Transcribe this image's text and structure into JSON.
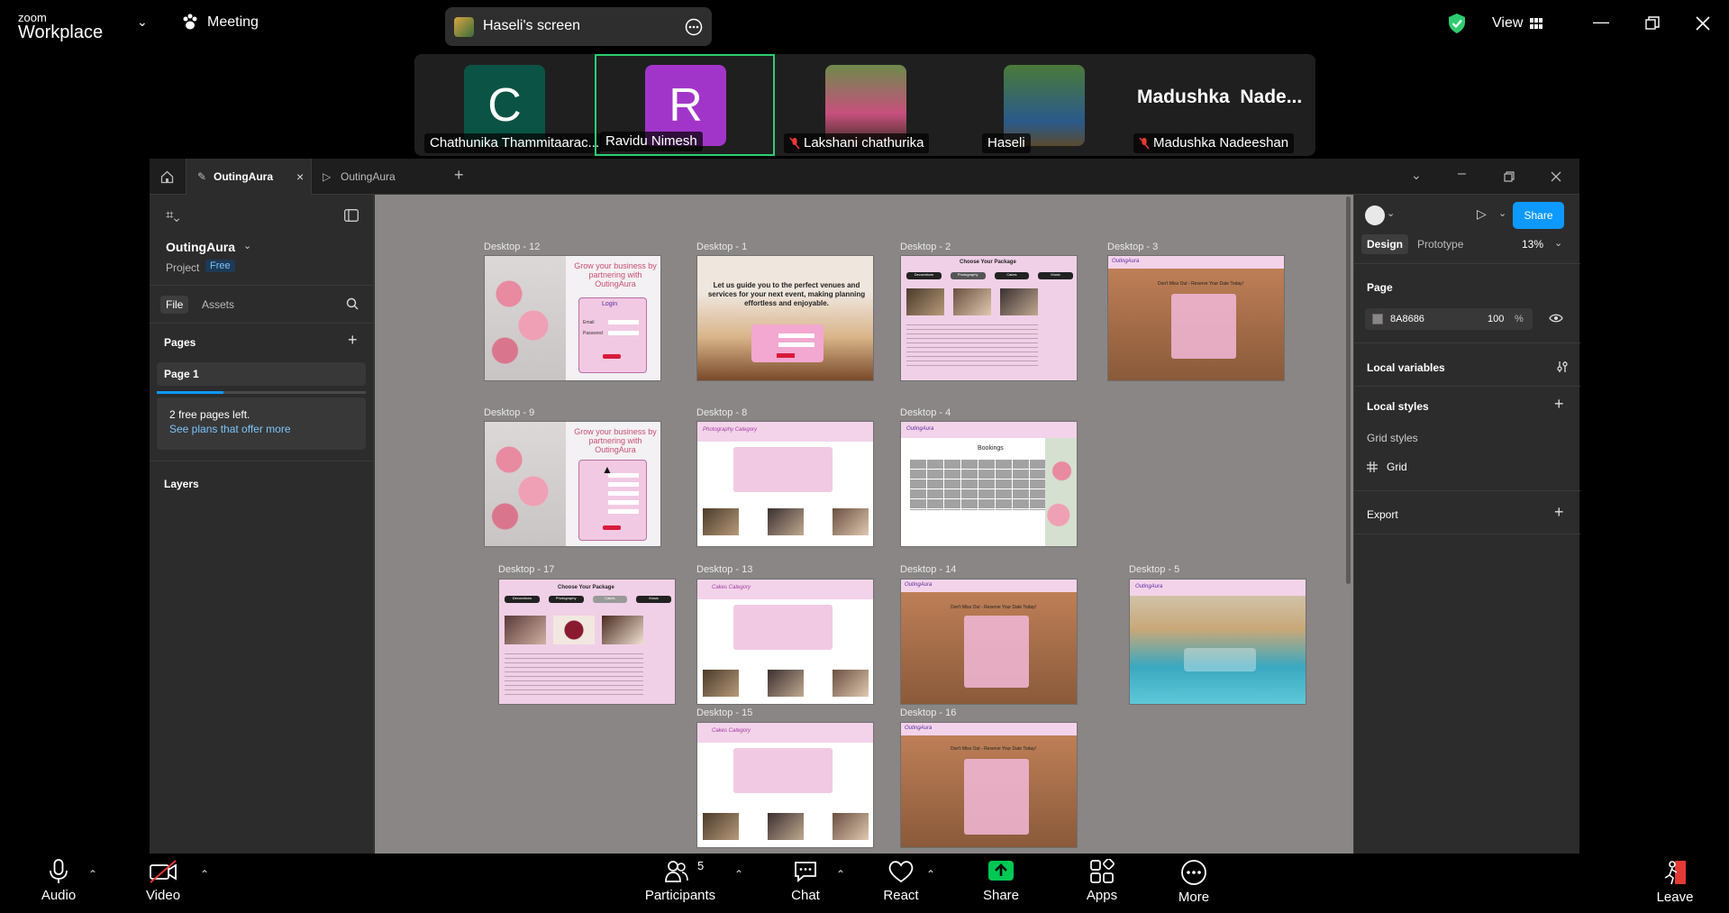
{
  "zoom": {
    "brand_small": "zoom",
    "brand_big": "Workplace",
    "meeting_label": "Meeting",
    "screen_label": "Haseli's screen",
    "view_label": "View",
    "colors": {
      "accent_green": "#2ecc71",
      "share_green": "#00c853",
      "leave_red": "#e53935"
    }
  },
  "participants": [
    {
      "initial": "C",
      "name": "Chathunika Thammitaarac...",
      "color": "#0b5345",
      "muted": false
    },
    {
      "initial": "R",
      "name": "Ravidu Nimesh",
      "color": "#a235c9",
      "muted": false,
      "active": true
    },
    {
      "initial": "",
      "name": "Lakshani chathurika",
      "color": "#4a6b3a",
      "muted": true
    },
    {
      "initial": "",
      "name": "Haseli",
      "color": "#3d6e3a",
      "muted": false
    },
    {
      "initial": "Madushka  Nade...",
      "name": "Madushka Nadeeshan",
      "color": "#1f1f1f",
      "muted": true
    }
  ],
  "figma": {
    "tabs": [
      {
        "label": "OutingAura",
        "active": true
      },
      {
        "label": "OutingAura",
        "active": false
      }
    ],
    "file_name": "OutingAura",
    "project_label": "Project",
    "plan_badge": "Free",
    "left_tabs": {
      "file": "File",
      "assets": "Assets"
    },
    "pages_heading": "Pages",
    "page_item": "Page 1",
    "free_pages_text": "2 free pages left.",
    "see_plans_link": "See plans that offer more",
    "layers_heading": "Layers",
    "right": {
      "share_label": "Share",
      "design_tab": "Design",
      "prototype_tab": "Prototype",
      "zoom_level": "13%",
      "page_heading": "Page",
      "page_color_hex": "8A8686",
      "page_opacity": "100",
      "percent_sign": "%",
      "local_variables": "Local variables",
      "local_styles": "Local styles",
      "grid_styles": "Grid styles",
      "grid_item": "Grid",
      "export_label": "Export"
    },
    "frames": [
      {
        "label": "Desktop - 12",
        "theme": "flowers-login"
      },
      {
        "label": "Desktop - 1",
        "theme": "event-hero"
      },
      {
        "label": "Desktop - 2",
        "theme": "package"
      },
      {
        "label": "Desktop - 3",
        "theme": "booking-form"
      },
      {
        "label": "Desktop - 9",
        "theme": "flowers-signup"
      },
      {
        "label": "Desktop - 8",
        "theme": "category"
      },
      {
        "label": "Desktop - 4",
        "theme": "bookings-table"
      },
      {
        "label": "Desktop - 17",
        "theme": "package"
      },
      {
        "label": "Desktop - 13",
        "theme": "category"
      },
      {
        "label": "Desktop - 14",
        "theme": "booking-form"
      },
      {
        "label": "Desktop - 5",
        "theme": "resort"
      },
      {
        "label": "Desktop - 15",
        "theme": "category"
      },
      {
        "label": "Desktop - 16",
        "theme": "booking-form"
      }
    ],
    "frame_text": {
      "grow_text": "Grow your business by partnering with OutingAura",
      "login_title": "Login",
      "email": "Email",
      "password": "Password",
      "hero_text": "Let us guide you to the perfect venues and services for your next event, making planning effortless and enjoyable.",
      "choose_package": "Choose Your Package",
      "decorations": "Decorations",
      "photography": "Photography",
      "cakes": "Cakes",
      "music": "Music",
      "brand": "OutingAura",
      "dont_miss": "Don't Miss Out - Reserve Your Date Today!",
      "photography_category": "Photography Category",
      "cakes_category": "Cakes Category",
      "bookings_title": "Bookings"
    }
  },
  "bottom_bar": {
    "audio": "Audio",
    "video": "Video",
    "participants": "Participants",
    "participants_count": "5",
    "chat": "Chat",
    "react": "React",
    "share": "Share",
    "apps": "Apps",
    "more": "More",
    "leave": "Leave"
  }
}
